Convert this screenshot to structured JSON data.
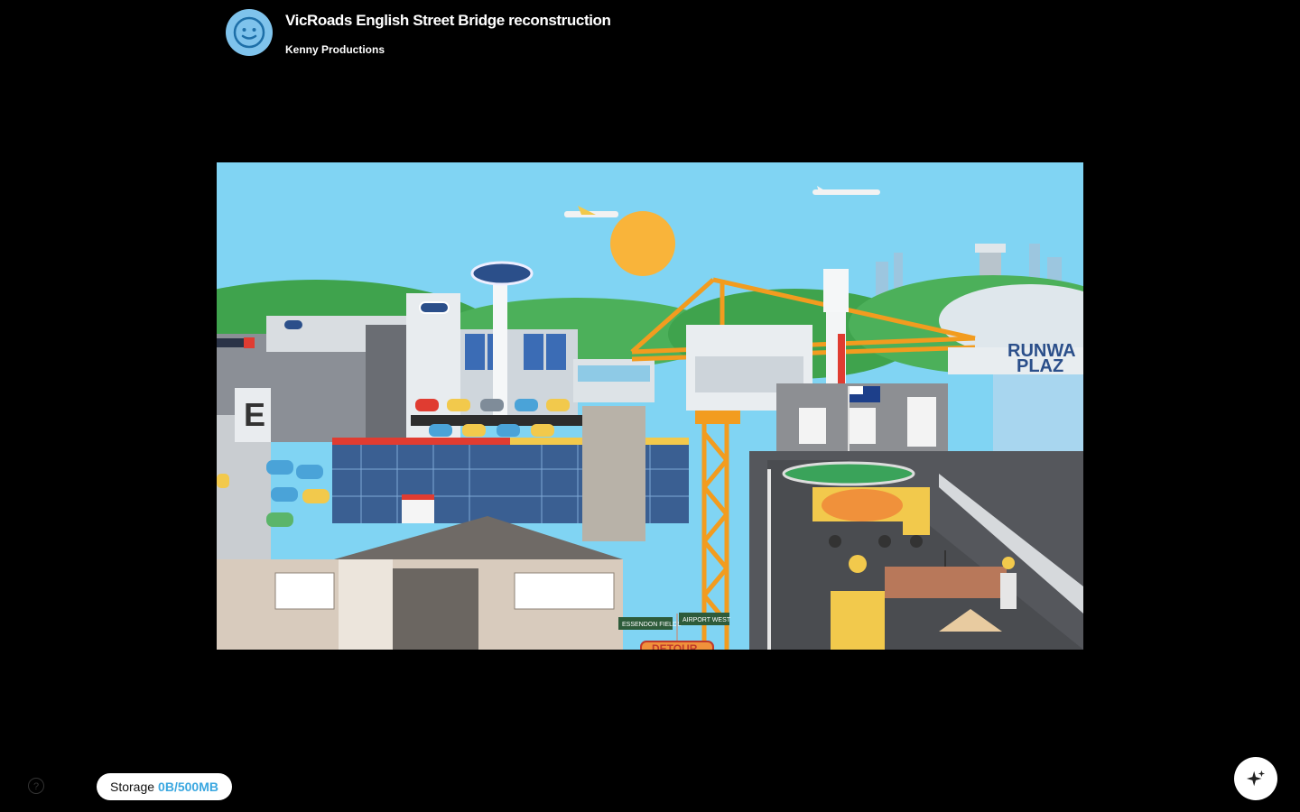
{
  "header": {
    "title": "VicRoads English Street Bridge reconstruction",
    "author": "Kenny Productions",
    "avatar_icon": "smiley-face-icon"
  },
  "video": {
    "scene_texts": {
      "plaza_line1": "RUNWA",
      "plaza_line2": "PLAZ",
      "sign_left": "ESSENDON FIELDS",
      "sign_right": "AIRPORT WEST",
      "detour": "DETOUR",
      "tower_letter": "E"
    }
  },
  "footer": {
    "help_icon": "question-icon",
    "storage_label": "Storage",
    "storage_value": "0B/500MB",
    "ai_button_icon": "sparkle-icon"
  },
  "colors": {
    "background": "#000000",
    "accent": "#3aa7e0",
    "avatar": "#7fc3ec"
  }
}
